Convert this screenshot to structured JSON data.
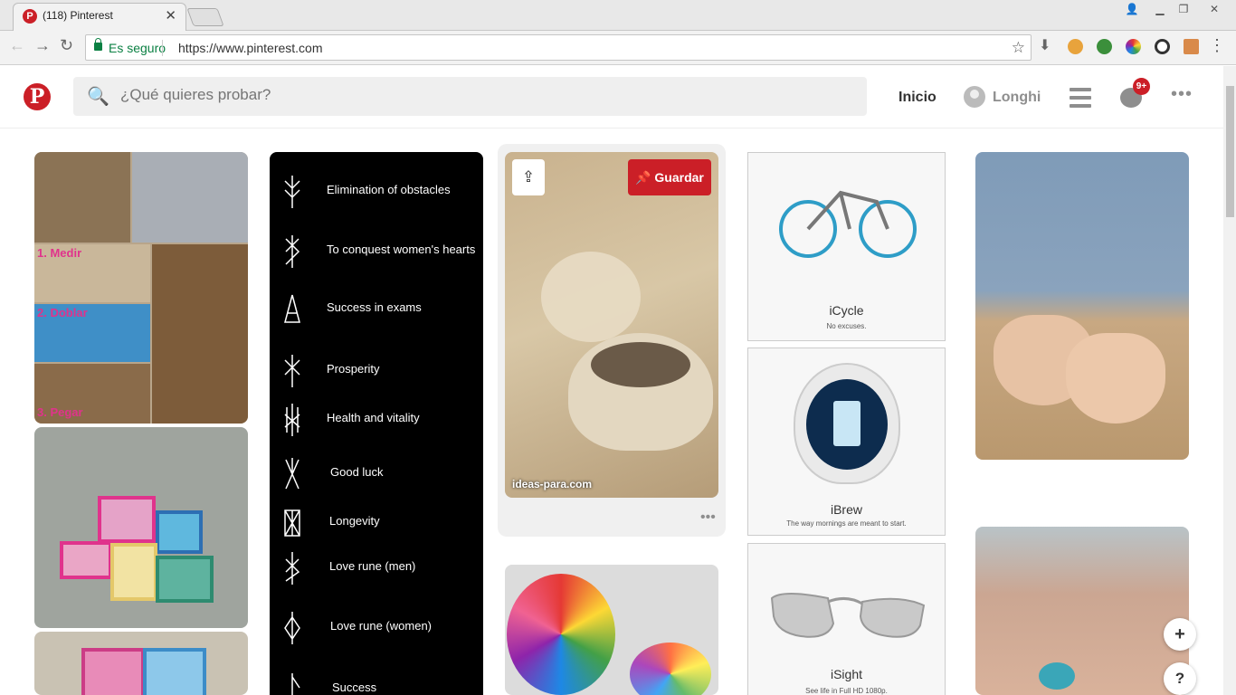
{
  "browser": {
    "tab_title": "(118) Pinterest",
    "tab_close": "✕",
    "secure_label": "Es seguro",
    "url": "https://www.pinterest.com"
  },
  "header": {
    "search_placeholder": "¿Qué quieres probar?",
    "nav_home": "Inicio",
    "user_name": "Longhi",
    "notif_badge": "9+"
  },
  "runes": [
    "Elimination of obstacles",
    "To conquest women's hearts",
    "Success in exams",
    "Prosperity",
    "Health and vitality",
    "Good luck",
    "Longevity",
    "Love rune (men)",
    "Love rune (women)",
    "Success"
  ],
  "pin_ideas": {
    "save_label": "Guardar",
    "source": "ideas-para.com"
  },
  "craft_steps": [
    "1. Medir",
    "2. Doblar",
    "3. Pegar"
  ],
  "products": [
    {
      "name": "iCycle",
      "tagline": "No excuses."
    },
    {
      "name": "iBrew",
      "tagline": "The way mornings are meant to start."
    },
    {
      "name": "iSight",
      "tagline": "See life in Full HD 1080p."
    }
  ],
  "colors": {
    "brand_red": "#cb1f27",
    "secure_green": "#0b8043"
  }
}
